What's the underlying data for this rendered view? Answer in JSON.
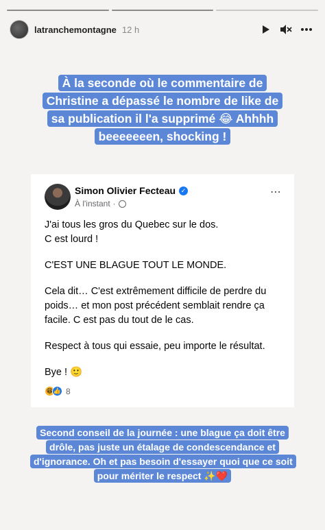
{
  "story": {
    "username": "latranchemontagne",
    "time": "12 h",
    "segments": 3,
    "active_segment": 1
  },
  "header_icons": [
    "play-icon",
    "mute-icon",
    "more-icon"
  ],
  "caption_top": "À la seconde où le commentaire de Christine a dépassé le nombre de like de sa publication il l'a supprimé 😂 Ahhhh beeeeeeen, shocking !",
  "post": {
    "author": "Simon Olivier Fecteau",
    "meta": "À l'instant",
    "more": "⋯",
    "paragraphs": [
      "J'ai tous les gros du Quebec sur le dos.\nC est lourd !",
      "C'EST UNE BLAGUE TOUT LE MONDE.",
      "Cela dit… C'est extrêmement difficile de perdre du poids… et mon post précédent semblait rendre ça facile. C est pas du tout de le cas.",
      "Respect à tous qui essaie, peu importe le résultat.",
      "Bye ! 🙂"
    ],
    "reaction_count": "8"
  },
  "caption_bottom": "Second conseil de la journée : une blague ça doit être drôle, pas juste un étalage de condescendance et d'ignorance. Oh et pas besoin d'essayer quoi que ce soit pour mériter le respect ✨❤️",
  "colors": {
    "caption_bg": "#5b87d6",
    "background": "#f4f3f1",
    "verified": "#1877f2"
  }
}
